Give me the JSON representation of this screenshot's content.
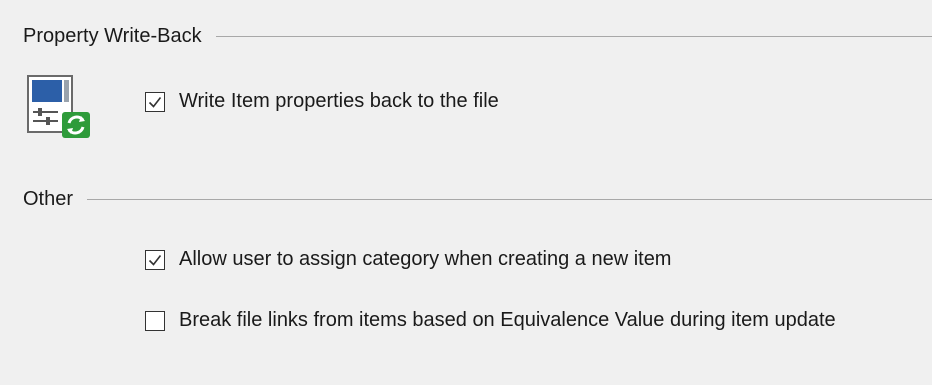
{
  "property_writeback": {
    "title": "Property Write-Back",
    "icon": "property-sync-icon",
    "write_back_option": {
      "label": "Write Item properties back to the file",
      "checked": true
    }
  },
  "other": {
    "title": "Other",
    "assign_category_option": {
      "label": "Allow user to assign category when creating a new item",
      "checked": true
    },
    "break_links_option": {
      "label": "Break file links from items based on Equivalence Value during item update",
      "checked": false
    }
  },
  "colors": {
    "panel_background": "#f0f0f0",
    "separator": "#a8a8a8",
    "icon_blue": "#2c5fa8",
    "icon_green": "#2e9b3a"
  }
}
